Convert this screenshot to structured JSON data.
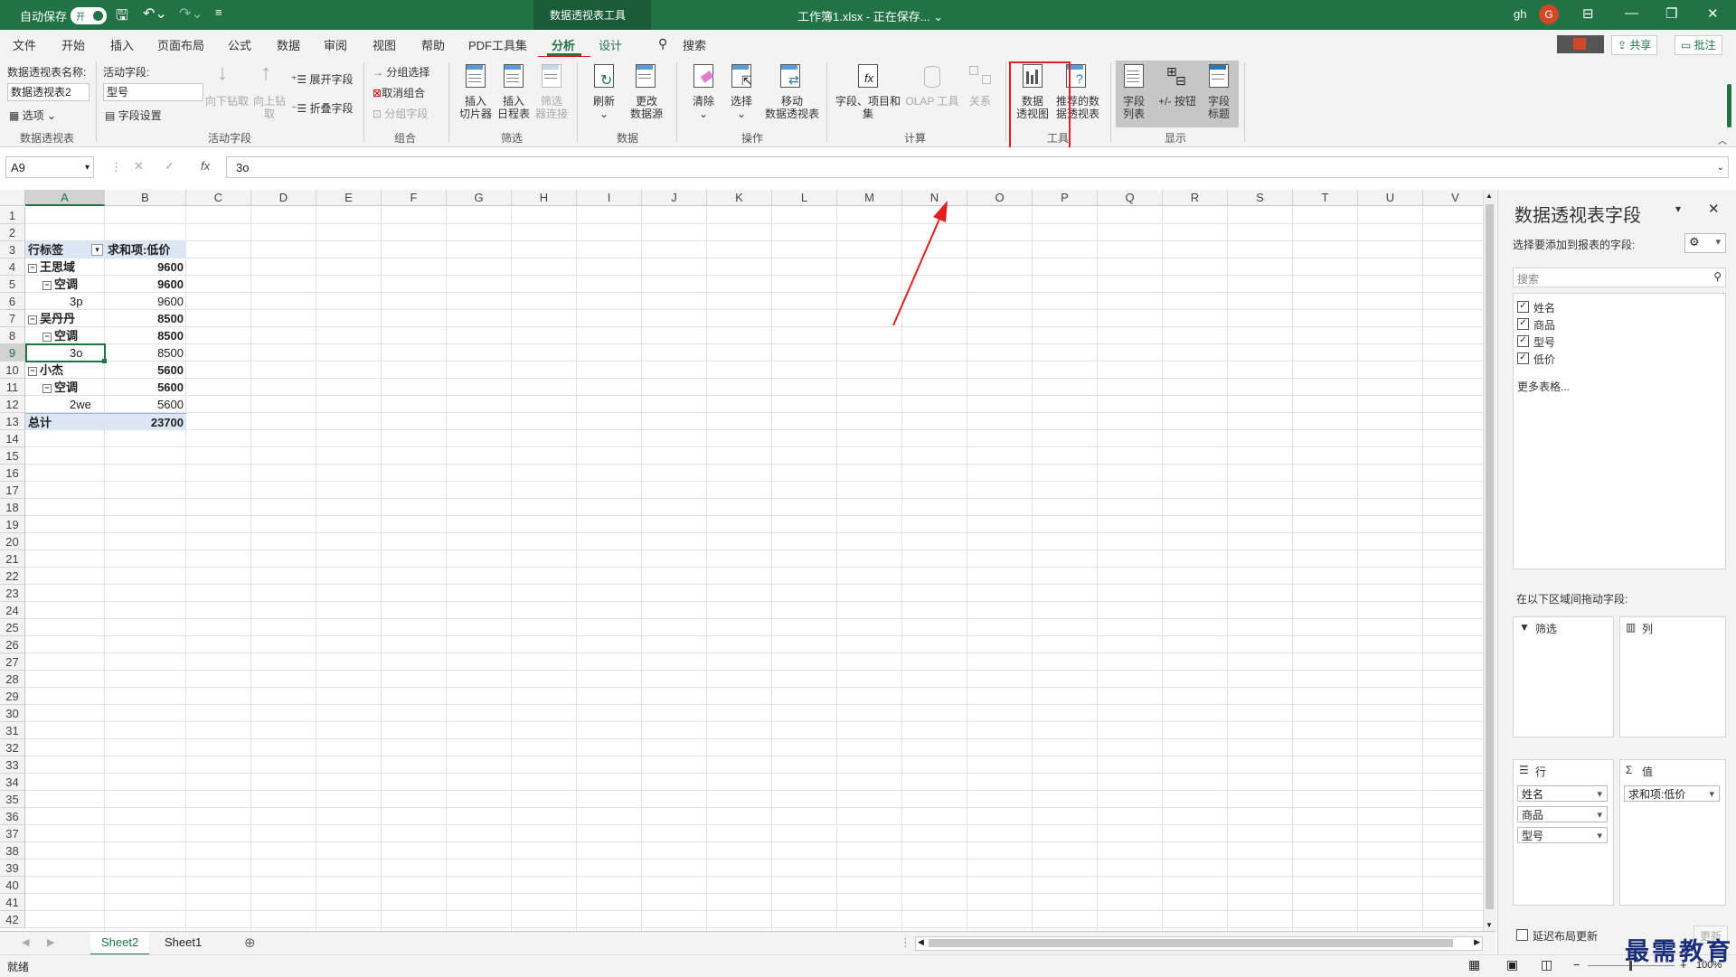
{
  "titlebar": {
    "autosave_label": "自动保存",
    "autosave_state": "开",
    "context_tools": "数据透视表工具",
    "doc_title": "工作簿1.xlsx - 正在保存... ⌄",
    "user": "gh",
    "avatar_letter": "G"
  },
  "tabs": [
    "文件",
    "开始",
    "插入",
    "页面布局",
    "公式",
    "数据",
    "审阅",
    "视图",
    "帮助",
    "PDF工具集",
    "分析",
    "设计",
    "搜索"
  ],
  "share": {
    "share_label": "共享",
    "comment_label": "批注"
  },
  "ribbon": {
    "pivot_name_label": "数据透视表名称:",
    "pivot_name_value": "数据透视表2",
    "options_label": "选项",
    "active_field_label": "活动字段:",
    "active_field_value": "型号",
    "field_settings_label": "字段设置",
    "drill_down": "向下钻取",
    "drill_up": "向上钻取",
    "expand_field": "展开字段",
    "collapse_field": "折叠字段",
    "group_selection": "分组选择",
    "ungroup": "取消组合",
    "group_field": "分组字段",
    "insert_slicer": "插入\n切片器",
    "insert_timeline": "插入\n日程表",
    "filter_connections": "筛选\n器连接",
    "refresh": "刷新",
    "change_source": "更改\n数据源",
    "clear": "清除",
    "select": "选择",
    "move_pivot": "移动\n数据透视表",
    "fields_items_sets": "字段、项目和\n集",
    "olap_tools": "OLAP 工具",
    "relationships": "关系",
    "pivot_chart": "数据\n透视图",
    "recommended_pivot": "推荐的数\n据透视表",
    "field_list": "字段\n列表",
    "buttons": "+/- 按钮",
    "field_headers": "字段\n标题",
    "groups": {
      "pivot": "数据透视表",
      "active": "活动字段",
      "group": "组合",
      "filter": "筛选",
      "data": "数据",
      "actions": "操作",
      "calc": "计算",
      "tools": "工具",
      "show": "显示"
    }
  },
  "formula_bar": {
    "cell_ref": "A9",
    "fx": "fx",
    "value": "3o"
  },
  "columns": [
    "A",
    "B",
    "C",
    "D",
    "E",
    "F",
    "G",
    "H",
    "I",
    "J",
    "K",
    "L",
    "M",
    "N",
    "O",
    "P",
    "Q",
    "R",
    "S",
    "T",
    "U",
    "V"
  ],
  "rows": [
    "1",
    "2",
    "3",
    "4",
    "5",
    "6",
    "7",
    "8",
    "9",
    "10",
    "11",
    "12",
    "13",
    "14",
    "15",
    "16",
    "17",
    "18",
    "19",
    "20",
    "21",
    "22",
    "23",
    "24",
    "25",
    "26",
    "27",
    "28",
    "29",
    "30",
    "31",
    "32",
    "33",
    "34",
    "35",
    "36",
    "37",
    "38",
    "39",
    "40",
    "41",
    "42"
  ],
  "pivot": {
    "header_row": "行标签",
    "header_value": "求和项:低价",
    "rows": [
      {
        "label": "王思域",
        "value": "9600",
        "level": 0
      },
      {
        "label": "空调",
        "value": "9600",
        "level": 1
      },
      {
        "label": "3p",
        "value": "9600",
        "level": 2
      },
      {
        "label": "吴丹丹",
        "value": "8500",
        "level": 0
      },
      {
        "label": "空调",
        "value": "8500",
        "level": 1
      },
      {
        "label": "3o",
        "value": "8500",
        "level": 2
      },
      {
        "label": "小杰",
        "value": "5600",
        "level": 0
      },
      {
        "label": "空调",
        "value": "5600",
        "level": 1
      },
      {
        "label": "2we",
        "value": "5600",
        "level": 2
      }
    ],
    "total_label": "总计",
    "total_value": "23700"
  },
  "sheets": [
    "Sheet2",
    "Sheet1"
  ],
  "status": {
    "ready": "就绪",
    "zoom": "100%"
  },
  "pane": {
    "title": "数据透视表字段",
    "subtitle": "选择要添加到报表的字段:",
    "search_placeholder": "搜索",
    "fields": [
      "姓名",
      "商品",
      "型号",
      "低价"
    ],
    "more_tables": "更多表格...",
    "drag_hint": "在以下区域间拖动字段:",
    "filters_label": "筛选",
    "columns_label": "列",
    "rows_label": "行",
    "values_label": "值",
    "row_fields": [
      "姓名",
      "商品",
      "型号"
    ],
    "value_fields": [
      "求和项:低价"
    ],
    "defer_update": "延迟布局更新",
    "update_btn": "更新"
  },
  "watermark": "最需教育"
}
